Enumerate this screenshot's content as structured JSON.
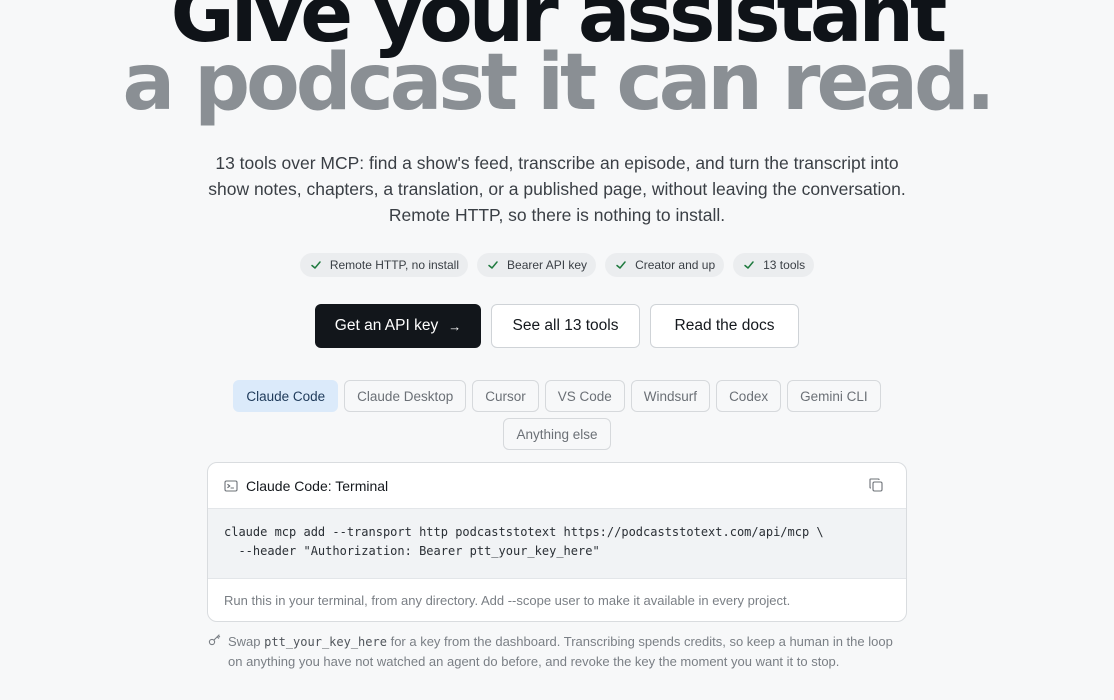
{
  "hero": {
    "line1": "Give your assistant",
    "line2": "a podcast it can read."
  },
  "subtitle": "13 tools over MCP: find a show's feed, transcribe an episode, and turn the transcript into show notes, chapters, a translation, or a published page, without leaving the conversation. Remote HTTP, so there is nothing to install.",
  "badges": [
    "Remote HTTP, no install",
    "Bearer API key",
    "Creator and up",
    "13 tools"
  ],
  "ctas": {
    "primary": "Get an API key",
    "primary_icon": "arrow-right-icon",
    "secondary1": "See all 13 tools",
    "secondary2": "Read the docs"
  },
  "clients": {
    "selected": "Claude Code",
    "items": [
      "Claude Code",
      "Claude Desktop",
      "Cursor",
      "VS Code",
      "Windsurf",
      "Codex",
      "Gemini CLI",
      "Anything else"
    ]
  },
  "panel": {
    "title": "Claude Code: Terminal",
    "code": "claude mcp add --transport http podcaststotext https://podcaststotext.com/api/mcp \\\n  --header \"Authorization: Bearer ptt_your_key_here\"",
    "footer": "Run this in your terminal, from any directory. Add --scope user to make it available in every project."
  },
  "note": {
    "prefix": "Swap ",
    "code": "ptt_your_key_here",
    "suffix": " for a key from the dashboard. Transcribing spends credits, so keep a human in the loop on anything you have not watched an agent do before, and revoke the key the moment you want it to stop."
  },
  "colors": {
    "background": "#f7f8f9",
    "primary_button": "#12161b",
    "active_chip": "#dbeafa",
    "hero_muted": "#8a8f94"
  }
}
